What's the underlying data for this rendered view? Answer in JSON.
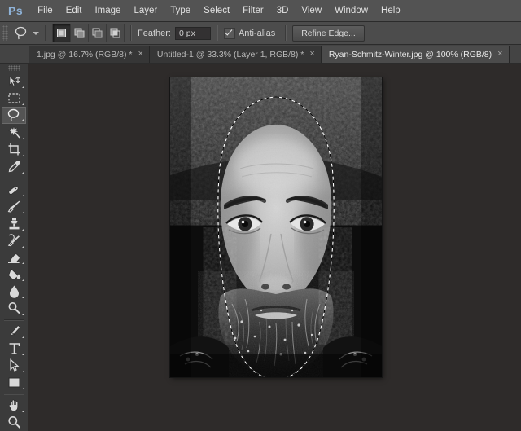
{
  "app": {
    "logo": "Ps",
    "name": "Adobe Photoshop"
  },
  "menubar": {
    "items": [
      {
        "label": "File"
      },
      {
        "label": "Edit"
      },
      {
        "label": "Image"
      },
      {
        "label": "Layer"
      },
      {
        "label": "Type"
      },
      {
        "label": "Select"
      },
      {
        "label": "Filter"
      },
      {
        "label": "3D"
      },
      {
        "label": "View"
      },
      {
        "label": "Window"
      },
      {
        "label": "Help"
      }
    ]
  },
  "options_bar": {
    "tool_icon": "lasso-icon",
    "tool_preset_dropdown": "chevron-down-icon",
    "selection_modes": [
      {
        "name": "new-selection",
        "label": "New selection",
        "active": true
      },
      {
        "name": "add-to-selection",
        "label": "Add to selection",
        "active": false
      },
      {
        "name": "subtract-from-selection",
        "label": "Subtract from selection",
        "active": false
      },
      {
        "name": "intersect-with-selection",
        "label": "Intersect with selection",
        "active": false
      }
    ],
    "feather_label": "Feather:",
    "feather_value": "0 px",
    "feather_placeholder": "0 px",
    "antialias_label": "Anti-alias",
    "antialias_checked": true,
    "refine_edge_label": "Refine Edge..."
  },
  "tabs": [
    {
      "title": "1.jpg @ 16.7% (RGB/8) *",
      "active": false,
      "close": "×"
    },
    {
      "title": "Untitled-1 @ 33.3% (Layer 1, RGB/8) *",
      "active": false,
      "close": "×"
    },
    {
      "title": "Ryan-Schmitz-Winter.jpg @ 100% (RGB/8)",
      "active": true,
      "close": "×"
    }
  ],
  "toolbar": {
    "groups": [
      [
        {
          "name": "move-tool",
          "label": "Move Tool",
          "active": false
        },
        {
          "name": "rectangular-marquee-tool",
          "label": "Rectangular Marquee Tool",
          "active": false
        },
        {
          "name": "lasso-tool",
          "label": "Lasso Tool",
          "active": true
        },
        {
          "name": "magic-wand-tool",
          "label": "Quick Selection / Magic Wand Tool",
          "active": false
        },
        {
          "name": "crop-tool",
          "label": "Crop Tool",
          "active": false
        },
        {
          "name": "eyedropper-tool",
          "label": "Eyedropper Tool",
          "active": false
        }
      ],
      [
        {
          "name": "healing-brush-tool",
          "label": "Spot Healing Brush Tool",
          "active": false
        },
        {
          "name": "brush-tool",
          "label": "Brush Tool",
          "active": false
        },
        {
          "name": "clone-stamp-tool",
          "label": "Clone Stamp Tool",
          "active": false
        },
        {
          "name": "history-brush-tool",
          "label": "History Brush Tool",
          "active": false
        },
        {
          "name": "eraser-tool",
          "label": "Eraser Tool",
          "active": false
        },
        {
          "name": "gradient-tool",
          "label": "Gradient / Paint Bucket Tool",
          "active": false
        },
        {
          "name": "blur-tool",
          "label": "Blur Tool",
          "active": false
        },
        {
          "name": "dodge-tool",
          "label": "Dodge Tool",
          "active": false
        }
      ],
      [
        {
          "name": "pen-tool",
          "label": "Pen Tool",
          "active": false
        },
        {
          "name": "type-tool",
          "label": "Horizontal Type Tool",
          "active": false
        },
        {
          "name": "path-selection-tool",
          "label": "Path Selection Tool",
          "active": false
        },
        {
          "name": "rectangle-tool",
          "label": "Rectangle Tool",
          "active": false
        }
      ],
      [
        {
          "name": "hand-tool",
          "label": "Hand Tool",
          "active": false
        },
        {
          "name": "zoom-tool",
          "label": "Zoom Tool",
          "active": false
        }
      ]
    ]
  },
  "document": {
    "filename": "Ryan-Schmitz-Winter.jpg",
    "zoom": "100%",
    "color_mode": "RGB/8",
    "image_description": "Black and white close-up portrait of a bearded man in a winter hat with frost on his face and beard",
    "selection_active": true,
    "selection_type": "lasso-marching-ants"
  },
  "colors": {
    "menu_bar_bg": "#535353",
    "options_bar_bg": "#4c4c4c",
    "tab_bar_bg": "#444444",
    "active_tab_bg": "#4b4b4b",
    "inactive_tab_bg": "#363636",
    "toolbar_bg": "#3b3b3b",
    "canvas_bg": "#2e2b2a",
    "accent_logo": "#8fb3d9",
    "text_primary": "#e0e0e0"
  }
}
